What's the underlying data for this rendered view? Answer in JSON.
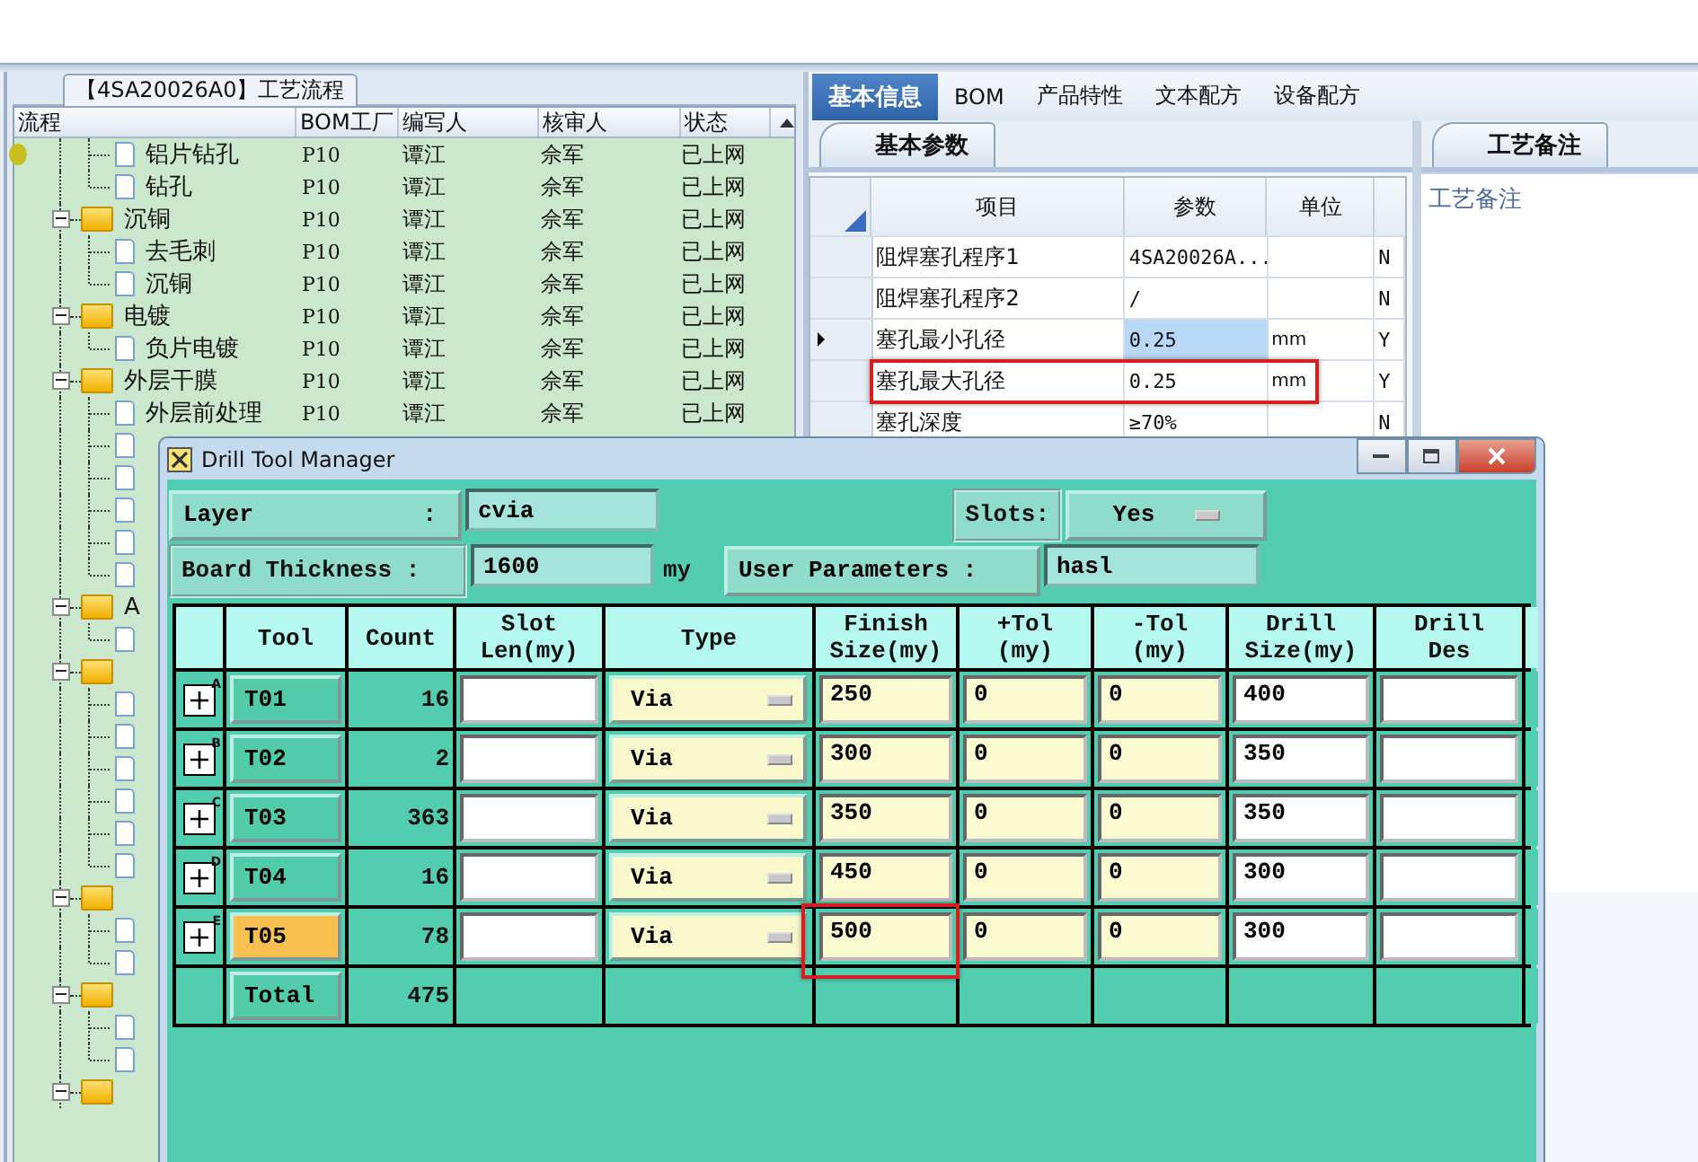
{
  "left_panel": {
    "title": "【4SA20026A0】工艺流程",
    "columns": [
      "流程",
      "BOM工厂",
      "编写人",
      "核审人",
      "状态"
    ],
    "tree": [
      {
        "kind": "continued",
        "children": [
          {
            "kind": "leaf",
            "label": "铝片钻孔",
            "bom": "P10",
            "writer": "谭江",
            "reviewer": "佘军",
            "status": "已上网"
          },
          {
            "kind": "leaf",
            "label": "钻孔",
            "bom": "P10",
            "writer": "谭江",
            "reviewer": "佘军",
            "status": "已上网"
          }
        ]
      },
      {
        "kind": "folder",
        "expanded": true,
        "label": "沉铜",
        "bom": "P10",
        "writer": "谭江",
        "reviewer": "佘军",
        "status": "已上网",
        "children": [
          {
            "kind": "leaf",
            "label": "去毛刺",
            "bom": "P10",
            "writer": "谭江",
            "reviewer": "佘军",
            "status": "已上网"
          },
          {
            "kind": "leaf",
            "label": "沉铜",
            "bom": "P10",
            "writer": "谭江",
            "reviewer": "佘军",
            "status": "已上网"
          }
        ]
      },
      {
        "kind": "folder",
        "expanded": true,
        "label": "电镀",
        "bom": "P10",
        "writer": "谭江",
        "reviewer": "佘军",
        "status": "已上网",
        "children": [
          {
            "kind": "leaf",
            "label": "负片电镀",
            "bom": "P10",
            "writer": "谭江",
            "reviewer": "佘军",
            "status": "已上网"
          }
        ]
      },
      {
        "kind": "folder",
        "expanded": true,
        "label": "外层干膜",
        "bom": "P10",
        "writer": "谭江",
        "reviewer": "佘军",
        "status": "已上网",
        "children": [
          {
            "kind": "leaf",
            "label": "外层前处理",
            "bom": "P10",
            "writer": "谭江",
            "reviewer": "佘军",
            "status": "已上网"
          },
          {
            "kind": "leaf"
          },
          {
            "kind": "leaf"
          },
          {
            "kind": "leaf"
          },
          {
            "kind": "leaf"
          },
          {
            "kind": "leaf"
          }
        ]
      },
      {
        "kind": "folder",
        "expanded": true,
        "label": "A",
        "children": [
          {
            "kind": "leaf"
          }
        ]
      },
      {
        "kind": "folder",
        "expanded": true,
        "children": [
          {
            "kind": "leaf"
          },
          {
            "kind": "leaf"
          },
          {
            "kind": "leaf"
          },
          {
            "kind": "leaf"
          },
          {
            "kind": "leaf"
          },
          {
            "kind": "leaf"
          }
        ]
      },
      {
        "kind": "folder",
        "expanded": true,
        "children": [
          {
            "kind": "leaf"
          },
          {
            "kind": "leaf"
          }
        ]
      },
      {
        "kind": "folder",
        "expanded": true,
        "children": [
          {
            "kind": "leaf"
          },
          {
            "kind": "leaf"
          }
        ]
      },
      {
        "kind": "folder",
        "expanded": true
      }
    ]
  },
  "right_panel": {
    "tabs": [
      {
        "label": "基本信息",
        "selected": true
      },
      {
        "label": "BOM",
        "selected": false
      },
      {
        "label": "产品特性",
        "selected": false
      },
      {
        "label": "文本配方",
        "selected": false
      },
      {
        "label": "设备配方",
        "selected": false
      }
    ],
    "params": {
      "tab": "基本参数",
      "columns": [
        "项目",
        "参数",
        "单位"
      ],
      "rows": [
        {
          "item": "阻焊塞孔程序1",
          "value": "4SA20026A...",
          "flag": "N",
          "selected": false
        },
        {
          "item": "阻焊塞孔程序2",
          "value": "/",
          "flag": "N",
          "selected": false
        },
        {
          "item": "塞孔最小孔径",
          "value": "0.25",
          "unit": "mm",
          "flag": "Y",
          "selected": true
        },
        {
          "item": "塞孔最大孔径",
          "value": "0.25",
          "unit": "mm",
          "flag": "Y",
          "selected": false
        },
        {
          "item": "塞孔深度",
          "value": "≥70%",
          "flag": "N",
          "selected": false
        }
      ]
    },
    "notes": {
      "tab": "工艺备注",
      "label": "工艺备注"
    }
  },
  "dialog": {
    "title": "Drill Tool Manager",
    "layer": {
      "label": "Layer",
      "separator": ":",
      "value": "cvia"
    },
    "slots": {
      "label": "Slots:",
      "value": "Yes"
    },
    "board_thickness": {
      "label": "Board Thickness :",
      "value": "1600",
      "unit": "my"
    },
    "user_parameters": {
      "label": "User Parameters :",
      "value": "hasl"
    },
    "columns": [
      "Tool",
      "Count",
      "Slot\nLen(my)",
      "Type",
      "Finish\nSize(my)",
      "+Tol\n(my)",
      "-Tol\n(my)",
      "Drill\nSize(my)",
      "Drill\nDes"
    ],
    "rows": [
      {
        "mark": "A",
        "tool": "T01",
        "count": "16",
        "type": "Via",
        "finish": "250",
        "plus_tol": "0",
        "minus_tol": "0",
        "drill": "400",
        "selected": false
      },
      {
        "mark": "B",
        "tool": "T02",
        "count": "2",
        "type": "Via",
        "finish": "300",
        "plus_tol": "0",
        "minus_tol": "0",
        "drill": "350",
        "selected": false
      },
      {
        "mark": "C",
        "tool": "T03",
        "count": "363",
        "type": "Via",
        "finish": "350",
        "plus_tol": "0",
        "minus_tol": "0",
        "drill": "350",
        "selected": false
      },
      {
        "mark": "D",
        "tool": "T04",
        "count": "16",
        "type": "Via",
        "finish": "450",
        "plus_tol": "0",
        "minus_tol": "0",
        "drill": "300",
        "selected": false
      },
      {
        "mark": "E",
        "tool": "T05",
        "count": "78",
        "type": "Via",
        "finish": "500",
        "plus_tol": "0",
        "minus_tol": "0",
        "drill": "300",
        "selected": true
      }
    ],
    "total": {
      "label": "Total",
      "count": "475"
    }
  }
}
